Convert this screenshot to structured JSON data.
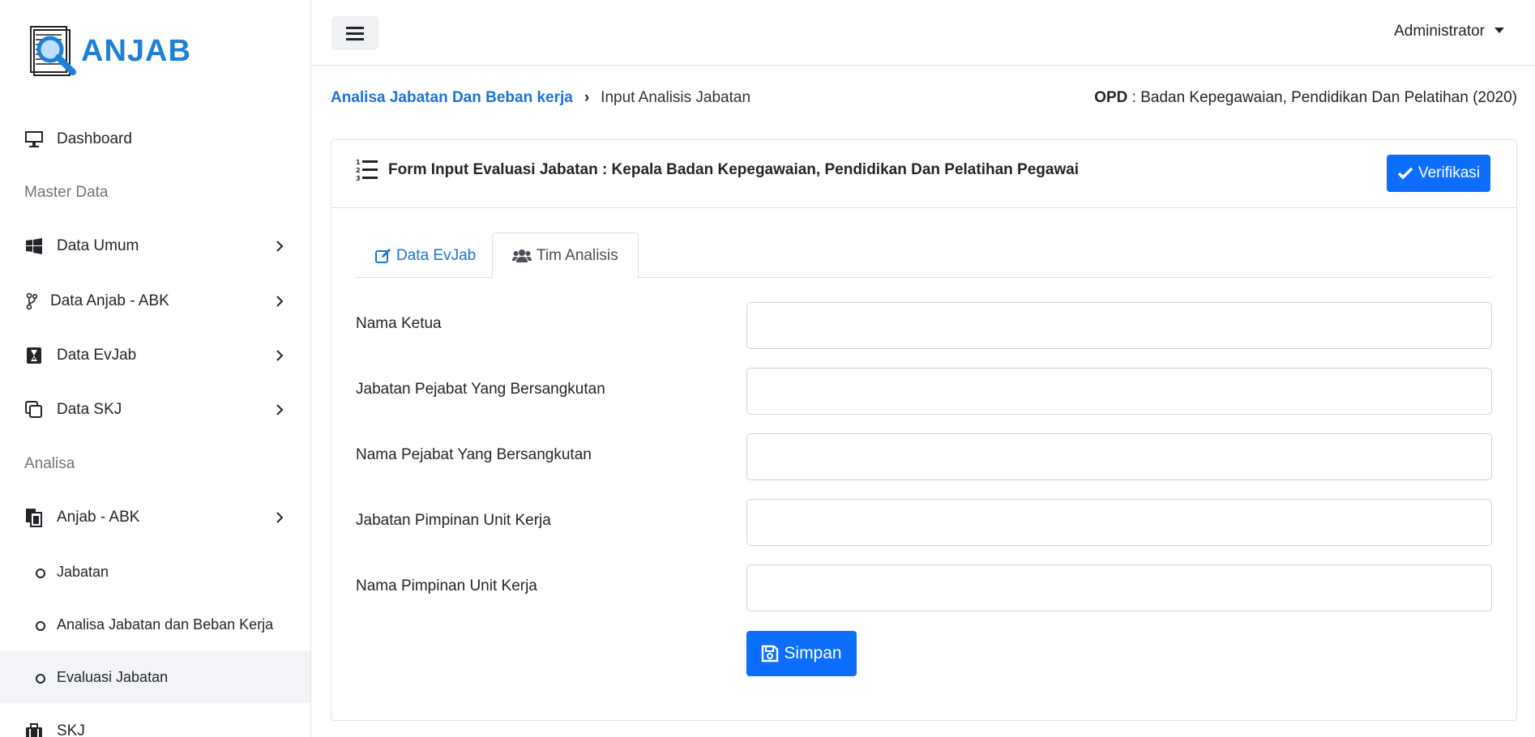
{
  "brand": {
    "name": "ANJAB"
  },
  "sidebar": {
    "dashboard": "Dashboard",
    "header_master": "Master Data",
    "data_umum": "Data Umum",
    "data_anjab": "Data Anjab - ABK",
    "data_evjab": "Data EvJab",
    "data_skj": "Data SKJ",
    "header_analisa": "Analisa",
    "anjab_abk": "Anjab - ABK",
    "sub_jabatan": "Jabatan",
    "sub_analisa": "Analisa Jabatan dan Beban Kerja",
    "sub_evaluasi": "Evaluasi Jabatan",
    "skj": "SKJ"
  },
  "topbar": {
    "user": "Administrator"
  },
  "breadcrumb": {
    "parent": "Analisa Jabatan Dan Beban kerja",
    "separator": "›",
    "current": "Input Analisis Jabatan"
  },
  "opd": {
    "label": "OPD",
    "value": " : Badan Kepegawaian, Pendidikan Dan Pelatihan (2020)"
  },
  "card": {
    "title": "Form Input Evaluasi Jabatan : Kepala Badan Kepegawaian, Pendidikan Dan Pelatihan Pegawai",
    "verify": "Verifikasi"
  },
  "tabs": {
    "data_evjab": "Data EvJab",
    "tim_analisis": "Tim Analisis"
  },
  "form": {
    "nama_ketua": "Nama Ketua",
    "jabatan_pejabat": "Jabatan Pejabat Yang Bersangkutan",
    "nama_pejabat": "Nama Pejabat Yang Bersangkutan",
    "jabatan_pimpinan": "Jabatan Pimpinan Unit Kerja",
    "nama_pimpinan": "Nama Pimpinan Unit Kerja",
    "save": "Simpan"
  },
  "colors": {
    "primary": "#0d6efd",
    "link": "#1a73d9",
    "brand": "#1e7fd6"
  }
}
